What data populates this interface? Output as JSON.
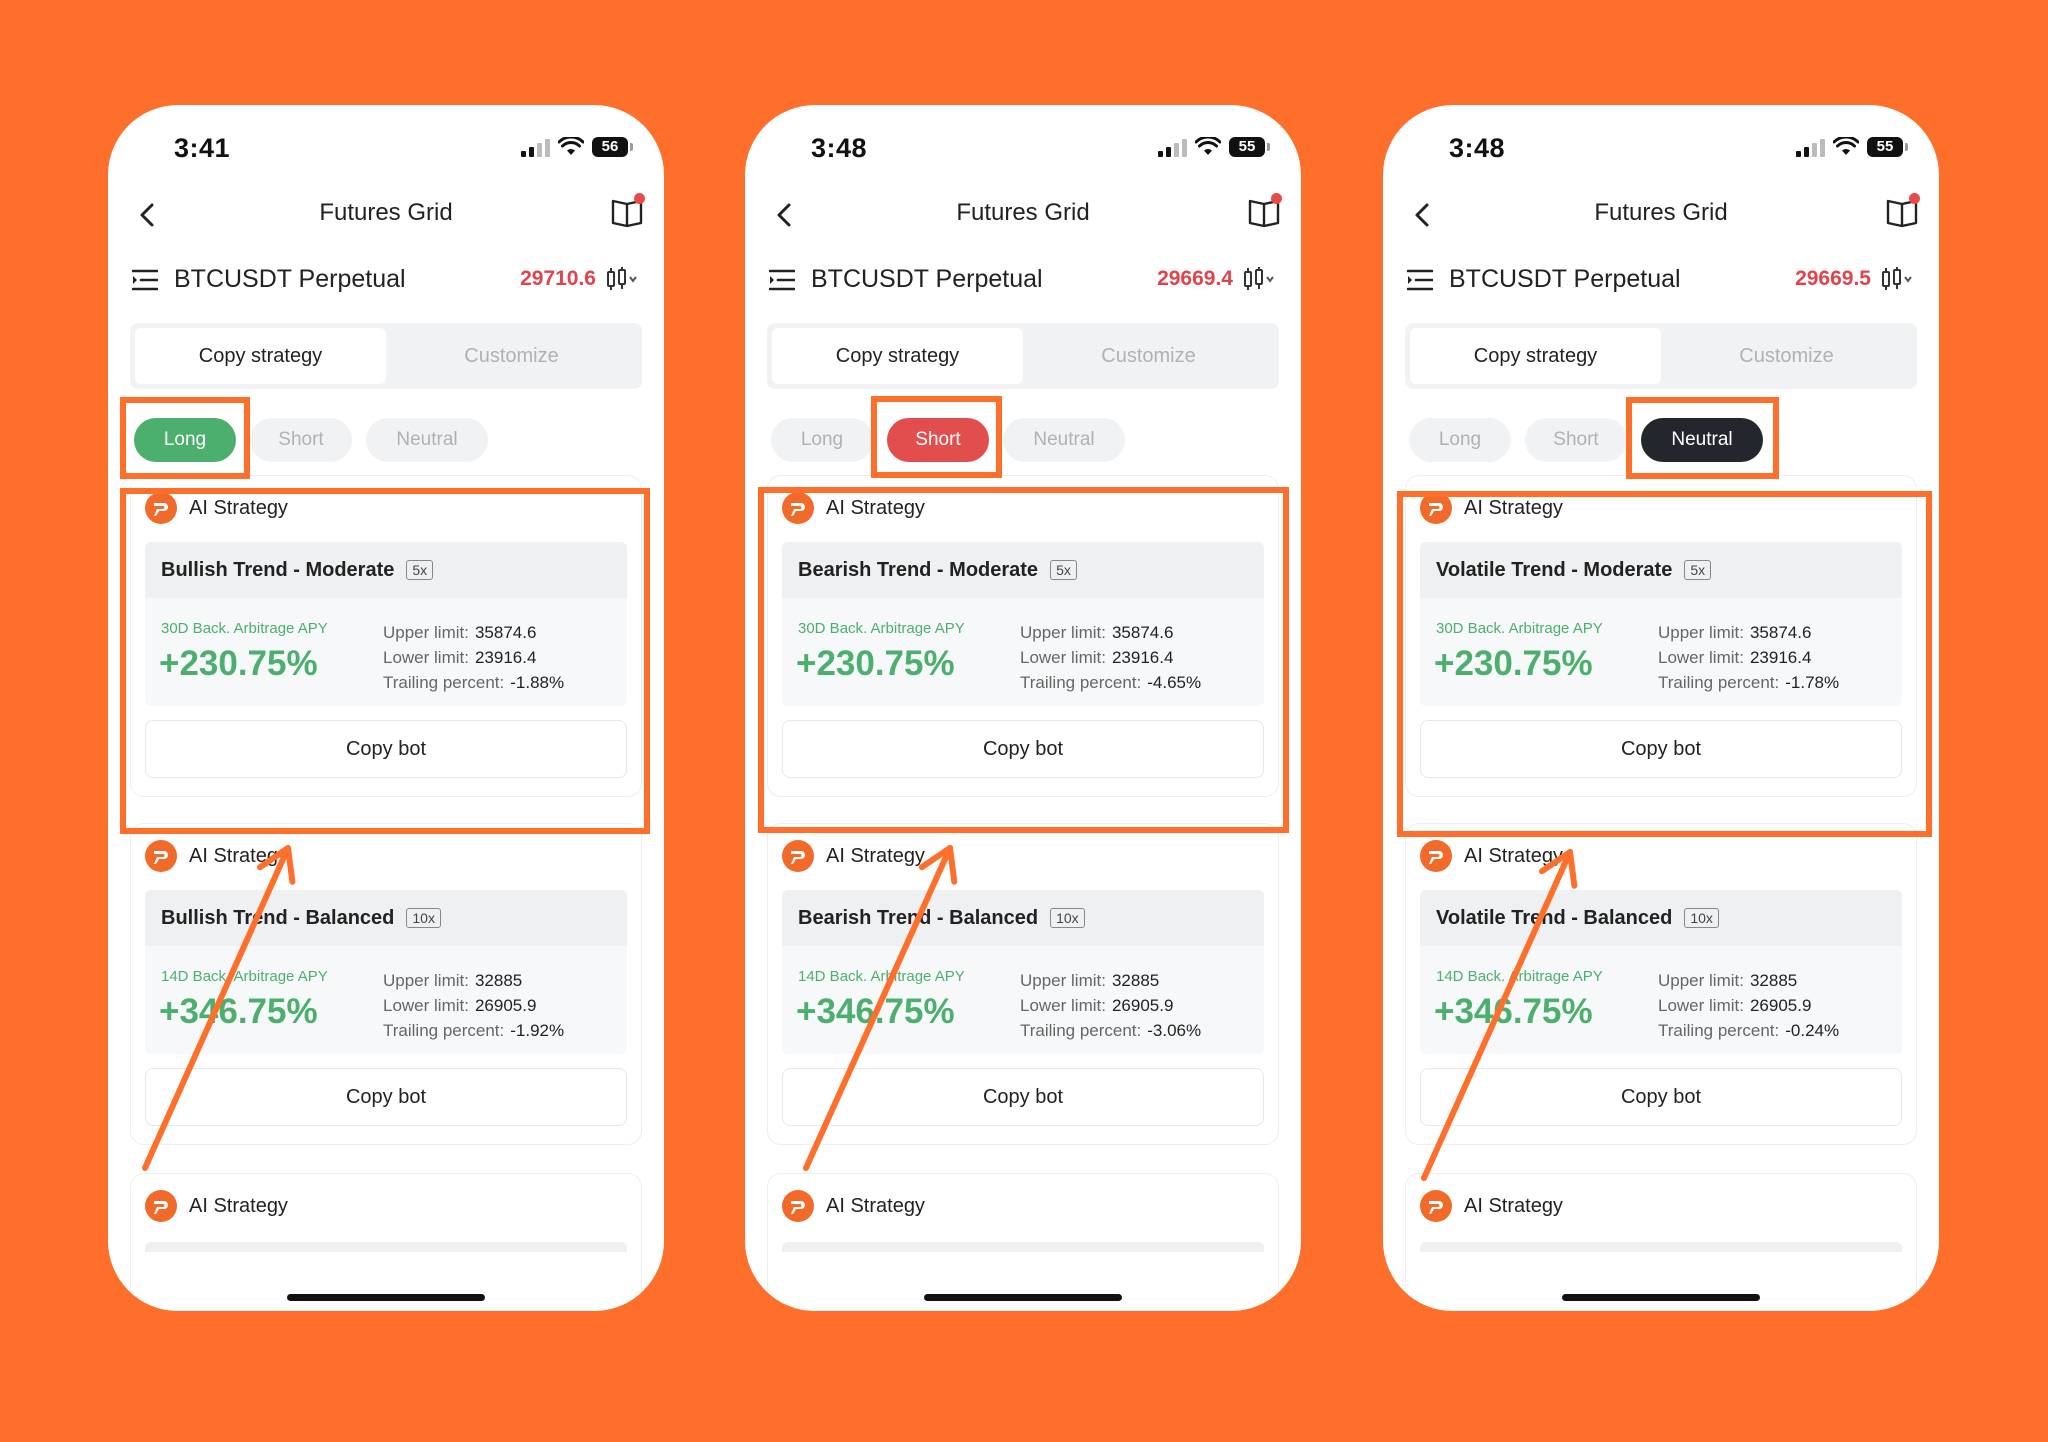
{
  "phones": [
    {
      "time": "3:41",
      "battery": "56",
      "nav_title": "Futures Grid",
      "pair": "BTCUSDT Perpetual",
      "price": "29710.6",
      "tabs": [
        "Copy strategy",
        "Customize"
      ],
      "pills": [
        "Long",
        "Short",
        "Neutral"
      ],
      "active_pill": "Long",
      "ai_label": "AI Strategy",
      "strategies": [
        {
          "name": "Bullish Trend - Moderate",
          "leverage": "5x",
          "apy_label": "30D Back. Arbitrage APY",
          "apy": "+230.75%",
          "upper_label": "Upper limit:",
          "upper": "35874.6",
          "lower_label": "Lower limit:",
          "lower": "23916.4",
          "trail_label": "Trailing percent:",
          "trail": "-1.88%",
          "button": "Copy bot"
        },
        {
          "name": "Bullish Trend - Balanced",
          "leverage": "10x",
          "apy_label": "14D Back. Arbitrage APY",
          "apy": "+346.75%",
          "upper_label": "Upper limit:",
          "upper": "32885",
          "lower_label": "Lower limit:",
          "lower": "26905.9",
          "trail_label": "Trailing percent:",
          "trail": "-1.92%",
          "button": "Copy bot"
        }
      ]
    },
    {
      "time": "3:48",
      "battery": "55",
      "nav_title": "Futures Grid",
      "pair": "BTCUSDT Perpetual",
      "price": "29669.4",
      "tabs": [
        "Copy strategy",
        "Customize"
      ],
      "pills": [
        "Long",
        "Short",
        "Neutral"
      ],
      "active_pill": "Short",
      "ai_label": "AI Strategy",
      "strategies": [
        {
          "name": "Bearish Trend - Moderate",
          "leverage": "5x",
          "apy_label": "30D Back. Arbitrage APY",
          "apy": "+230.75%",
          "upper_label": "Upper limit:",
          "upper": "35874.6",
          "lower_label": "Lower limit:",
          "lower": "23916.4",
          "trail_label": "Trailing percent:",
          "trail": "-4.65%",
          "button": "Copy bot"
        },
        {
          "name": "Bearish Trend - Balanced",
          "leverage": "10x",
          "apy_label": "14D Back. Arbitrage APY",
          "apy": "+346.75%",
          "upper_label": "Upper limit:",
          "upper": "32885",
          "lower_label": "Lower limit:",
          "lower": "26905.9",
          "trail_label": "Trailing percent:",
          "trail": "-3.06%",
          "button": "Copy bot"
        }
      ]
    },
    {
      "time": "3:48",
      "battery": "55",
      "nav_title": "Futures Grid",
      "pair": "BTCUSDT Perpetual",
      "price": "29669.5",
      "tabs": [
        "Copy strategy",
        "Customize"
      ],
      "pills": [
        "Long",
        "Short",
        "Neutral"
      ],
      "active_pill": "Neutral",
      "ai_label": "AI Strategy",
      "strategies": [
        {
          "name": "Volatile Trend - Moderate",
          "leverage": "5x",
          "apy_label": "30D Back. Arbitrage APY",
          "apy": "+230.75%",
          "upper_label": "Upper limit:",
          "upper": "35874.6",
          "lower_label": "Lower limit:",
          "lower": "23916.4",
          "trail_label": "Trailing percent:",
          "trail": "-1.78%",
          "button": "Copy bot"
        },
        {
          "name": "Volatile Trend - Balanced",
          "leverage": "10x",
          "apy_label": "14D Back. Arbitrage APY",
          "apy": "+346.75%",
          "upper_label": "Upper limit:",
          "upper": "32885",
          "lower_label": "Lower limit:",
          "lower": "26905.9",
          "trail_label": "Trailing percent:",
          "trail": "-0.24%",
          "button": "Copy bot"
        }
      ]
    }
  ],
  "colors": {
    "background": "#FF6F2C",
    "long": "#4CAF6D",
    "short": "#E24E4E",
    "neutral": "#23272d",
    "price": "#E0434B"
  }
}
